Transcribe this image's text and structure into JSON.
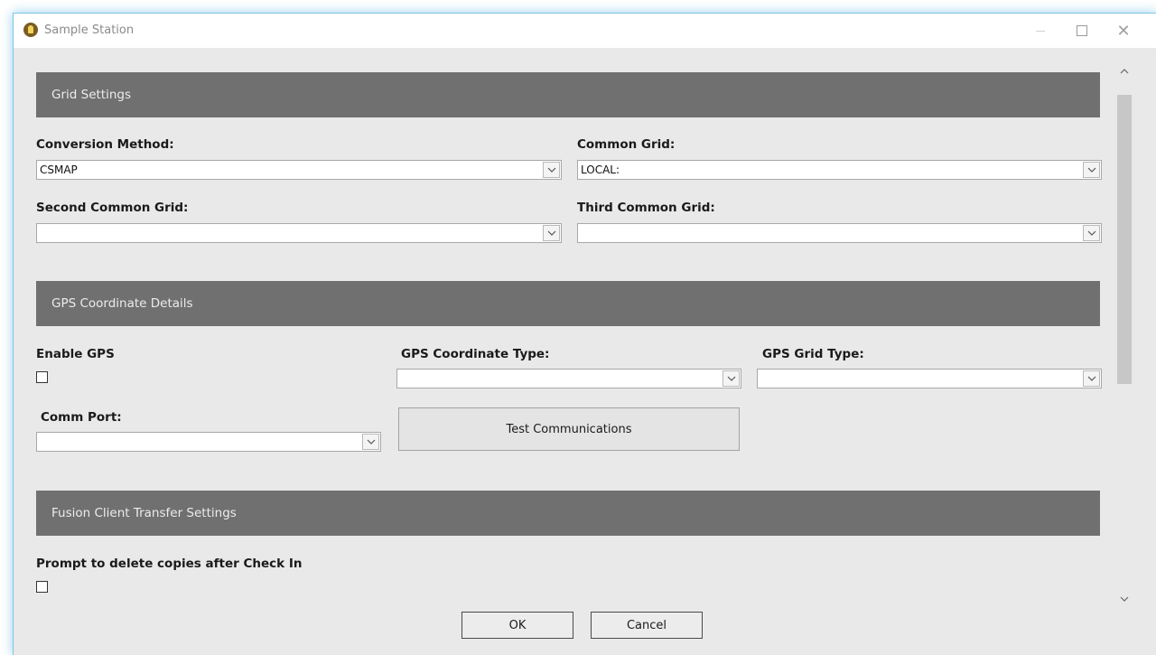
{
  "window": {
    "title": "Sample Station"
  },
  "grid_settings": {
    "header": "Grid Settings",
    "conversion_method": {
      "label": "Conversion Method:",
      "value": "CSMAP"
    },
    "common_grid": {
      "label": "Common Grid:",
      "value": "LOCAL:"
    },
    "second_common_grid": {
      "label": "Second Common Grid:",
      "value": ""
    },
    "third_common_grid": {
      "label": "Third Common Grid:",
      "value": ""
    }
  },
  "gps": {
    "header": "GPS Coordinate Details",
    "enable_gps": {
      "label": "Enable GPS",
      "checked": false
    },
    "coordinate_type": {
      "label": "GPS Coordinate Type:",
      "value": ""
    },
    "grid_type": {
      "label": "GPS Grid Type:",
      "value": ""
    },
    "comm_port": {
      "label": "Comm Port:",
      "value": ""
    },
    "test_button": "Test Communications"
  },
  "fusion": {
    "header": "Fusion Client Transfer Settings",
    "prompt_delete": {
      "label": "Prompt to delete copies after Check In",
      "checked": false
    }
  },
  "footer": {
    "ok": "OK",
    "cancel": "Cancel"
  },
  "icons": {
    "app": "key-icon",
    "dropdown": "chevron-down-icon",
    "scroll_up": "chevron-up-icon",
    "scroll_down": "chevron-down-icon"
  },
  "colors": {
    "section_header_bg": "#707070",
    "window_border": "#7fc6e8"
  }
}
